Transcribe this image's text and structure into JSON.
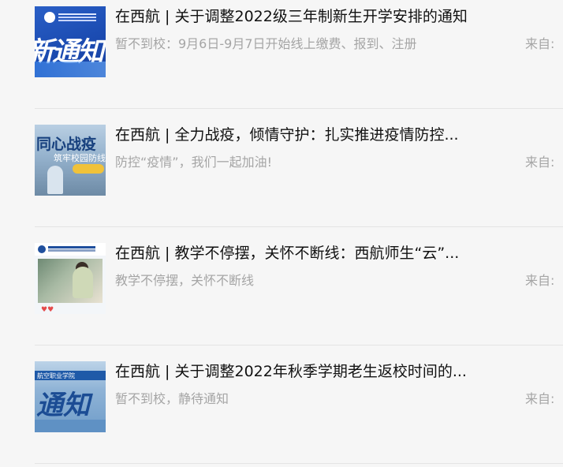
{
  "articles": [
    {
      "title": "在西航 | 关于调整2022级三年制新生开学安排的通知",
      "desc": "暂不到校：9月6日-9月7日开始线上缴费、报到、注册",
      "source": "来自:",
      "thumb_text": "新通知"
    },
    {
      "title": "在西航 | 全力战疫，倾情守护：扎实推进疫情防控...",
      "desc": "防控“疫情”，我们一起加油!",
      "source": "来自:",
      "thumb_text": "同心战疫",
      "thumb_sub": "筑牢校园防线"
    },
    {
      "title": "在西航 | 教学不停摆，关怀不断线：西航师生“云”...",
      "desc": "教学不停摆，关怀不断线",
      "source": "来自:"
    },
    {
      "title": "在西航 | 关于调整2022年秋季学期老生返校时间的...",
      "desc": "暂不到校，静待通知",
      "source": "来自:",
      "thumb_text": "通知",
      "thumb_header": "航空职业学院"
    }
  ]
}
